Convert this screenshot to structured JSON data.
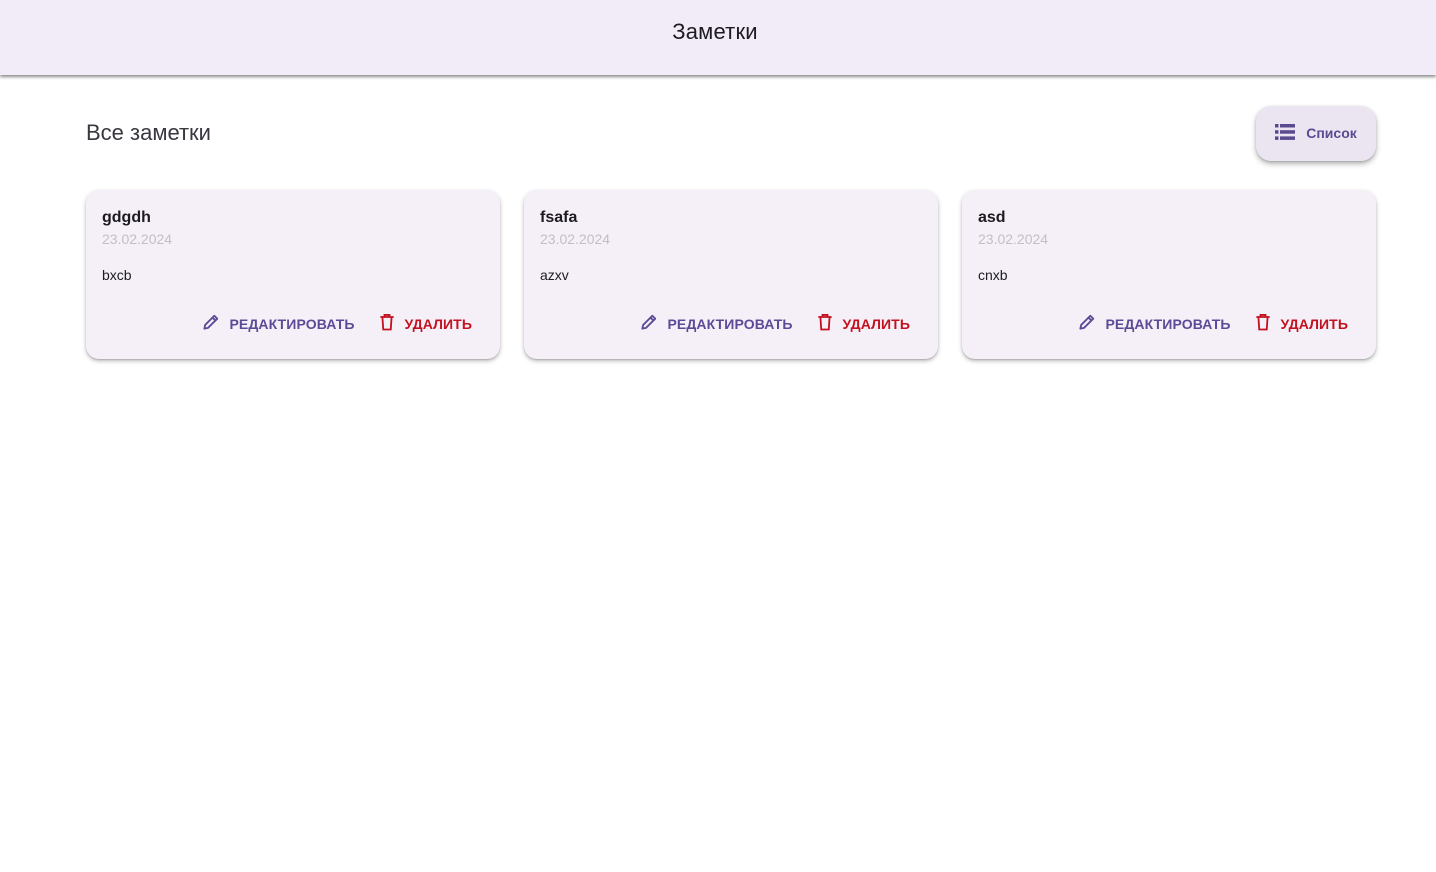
{
  "appbar": {
    "title": "Заметки"
  },
  "header": {
    "title": "Все заметки",
    "view_button": {
      "label": "Список",
      "icon": "list-icon"
    }
  },
  "colors": {
    "appbar_bg": "#f1ecf7",
    "card_bg": "#f5f0f8",
    "accent": "#5d4a96",
    "danger": "#c3111f",
    "date": "#c2bec8"
  },
  "notes": [
    {
      "title": "gdgdh",
      "date": "23.02.2024",
      "body": "bxcb",
      "edit_label": "РЕДАКТИРОВАТЬ",
      "delete_label": "УДАЛИТЬ"
    },
    {
      "title": "fsafa",
      "date": "23.02.2024",
      "body": "azxv",
      "edit_label": "РЕДАКТИРОВАТЬ",
      "delete_label": "УДАЛИТЬ"
    },
    {
      "title": "asd",
      "date": "23.02.2024",
      "body": "cnxb",
      "edit_label": "РЕДАКТИРОВАТЬ",
      "delete_label": "УДАЛИТЬ"
    }
  ]
}
